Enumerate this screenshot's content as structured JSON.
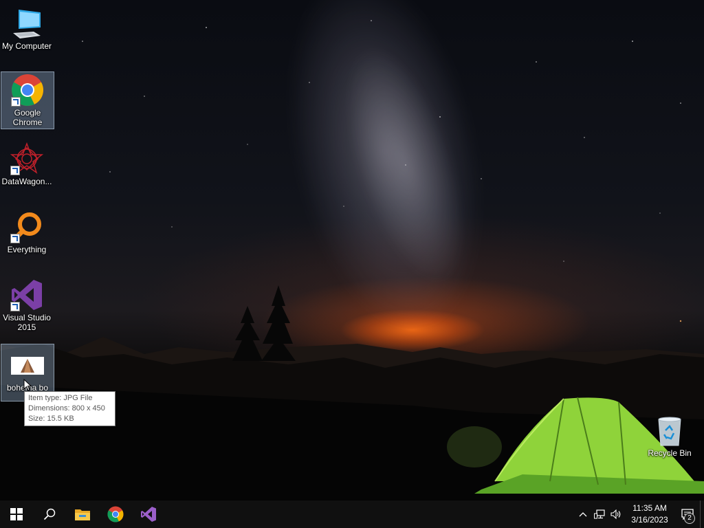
{
  "desktop": {
    "icons": [
      {
        "label": "My Computer",
        "icon": "computer-icon"
      },
      {
        "label": "Google Chrome",
        "icon": "chrome-icon",
        "shortcut": true
      },
      {
        "label": "DataWagon...",
        "icon": "datawagon-icon",
        "shortcut": true
      },
      {
        "label": "Everything",
        "icon": "everything-search-icon",
        "shortcut": true
      },
      {
        "label": "Visual Studio 2015",
        "icon": "visual-studio-icon",
        "shortcut": true
      },
      {
        "label": "bohema bo",
        "icon": "jpg-thumbnail-icon"
      },
      {
        "label": "Recycle Bin",
        "icon": "recycle-bin-icon"
      }
    ],
    "tooltip": {
      "item_type": "Item type: JPG File",
      "dimensions": "Dimensions: 800 x 450",
      "size": "Size: 15.5 KB"
    }
  },
  "taskbar": {
    "pinned": [
      {
        "icon": "windows-start-icon"
      },
      {
        "icon": "search-icon"
      },
      {
        "icon": "file-explorer-icon"
      },
      {
        "icon": "chrome-icon"
      },
      {
        "icon": "visual-studio-icon"
      }
    ],
    "tray": {
      "time": "11:35 AM",
      "date": "3/16/2023",
      "notification_count": "2"
    }
  },
  "colors": {
    "taskbar_bg": "#101010",
    "selection": "#a0bedc",
    "vs_purple": "#68217a",
    "chrome_red": "#db4437",
    "chrome_yellow": "#f4b400",
    "chrome_green": "#0f9d58",
    "chrome_blue": "#4285f4"
  }
}
